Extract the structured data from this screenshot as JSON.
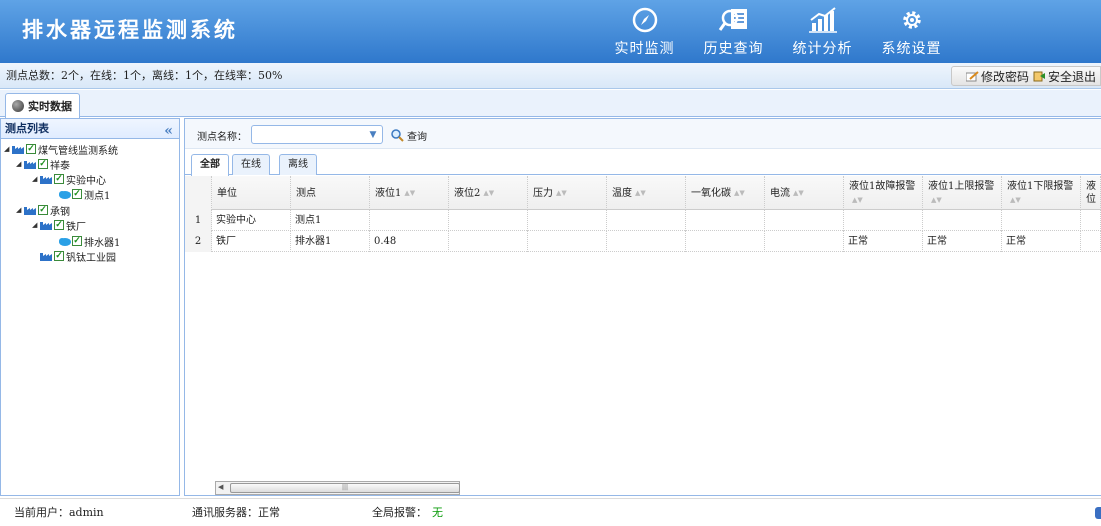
{
  "app": {
    "title": "排水器远程监测系统"
  },
  "nav": [
    {
      "label": "实时监测",
      "icon": "compass-icon"
    },
    {
      "label": "历史查询",
      "icon": "search-document-icon"
    },
    {
      "label": "统计分析",
      "icon": "bar-chart-icon"
    },
    {
      "label": "系统设置",
      "icon": "gear-icon"
    }
  ],
  "status": {
    "summary": "测点总数：2个，在线：1个，离线：1个，在线率：50%"
  },
  "top_actions": {
    "change_password": "修改密码",
    "logout": "安全退出"
  },
  "main_tab": {
    "label": "实时数据"
  },
  "left_panel": {
    "title": "测点列表",
    "tree": [
      {
        "label": "煤气管线监测系统"
      },
      {
        "label": "祥泰"
      },
      {
        "label": "实验中心"
      },
      {
        "label": "测点1"
      },
      {
        "label": "承钢"
      },
      {
        "label": "铁厂"
      },
      {
        "label": "排水器1"
      },
      {
        "label": "钒钛工业园"
      }
    ]
  },
  "search": {
    "label": "测点名称：",
    "select_value": "",
    "query_label": "查询"
  },
  "subtabs": [
    "全部",
    "在线",
    "离线"
  ],
  "table": {
    "columns": [
      "单位",
      "测点",
      "液位1",
      "液位2",
      "压力",
      "温度",
      "一氧化碳",
      "电流",
      "液位1故障报警",
      "液位1上限报警",
      "液位1下限报警",
      "液位"
    ],
    "rows": [
      {
        "num": "1",
        "cells": [
          "实验中心",
          "测点1",
          "",
          "",
          "",
          "",
          "",
          "",
          "",
          "",
          "",
          ""
        ]
      },
      {
        "num": "2",
        "cells": [
          "铁厂",
          "排水器1",
          "0.48",
          "",
          "",
          "",
          "",
          "",
          "正常",
          "正常",
          "正常",
          ""
        ]
      }
    ]
  },
  "footer": {
    "user_label": "当前用户：admin",
    "server_label": "通讯服务器：正常",
    "alarm_label": "全局报警：",
    "alarm_value": "无"
  }
}
